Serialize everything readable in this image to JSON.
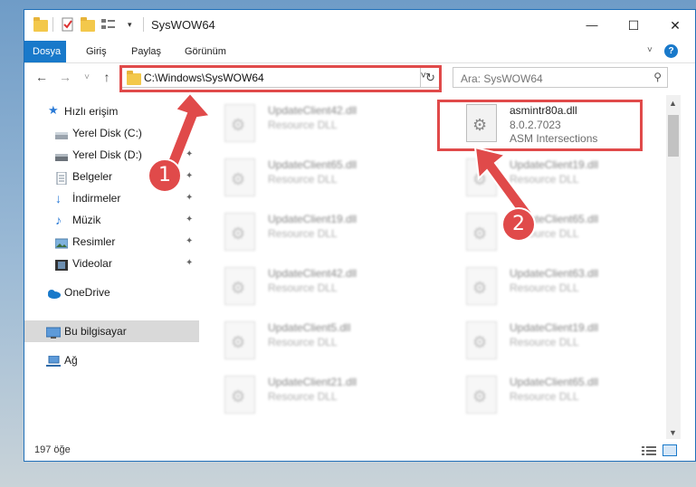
{
  "window": {
    "title": "SysWOW64",
    "minimize": "—",
    "maximize": "☐",
    "close": "✕"
  },
  "ribbon": {
    "tabs": [
      "Dosya",
      "Giriş",
      "Paylaş",
      "Görünüm"
    ],
    "help": "?"
  },
  "nav": {
    "back": "←",
    "forward": "→",
    "recent": "˅",
    "up": "↑"
  },
  "address": {
    "path": "C:\\Windows\\SysWOW64",
    "dropdown": "˅",
    "refresh": "↻"
  },
  "search": {
    "placeholder": "Ara: SysWOW64",
    "icon": "search-icon"
  },
  "sidebar": {
    "items": [
      {
        "label": "Hızlı erişim",
        "icon": "star-icon",
        "pinned": false
      },
      {
        "label": "Yerel Disk (C:)",
        "icon": "drive-icon",
        "pinned": true
      },
      {
        "label": "Yerel Disk (D:)",
        "icon": "drive-icon",
        "pinned": true
      },
      {
        "label": "Belgeler",
        "icon": "document-icon",
        "pinned": true
      },
      {
        "label": "İndirmeler",
        "icon": "download-icon",
        "pinned": true
      },
      {
        "label": "Müzik",
        "icon": "music-icon",
        "pinned": true
      },
      {
        "label": "Resimler",
        "icon": "pictures-icon",
        "pinned": true
      },
      {
        "label": "Videolar",
        "icon": "video-icon",
        "pinned": true
      },
      {
        "label": "OneDrive",
        "icon": "cloud-icon",
        "pinned": false
      },
      {
        "label": "Bu bilgisayar",
        "icon": "computer-icon",
        "pinned": false,
        "selected": true
      },
      {
        "label": "Ağ",
        "icon": "network-icon",
        "pinned": false
      }
    ],
    "pin_glyph": "📌"
  },
  "files": {
    "highlighted": {
      "name": "asmintr80a.dll",
      "version": "8.0.2.7023",
      "description": "ASM Intersections"
    },
    "left_column": [
      {
        "name": "UpdateClient42.dll",
        "type": "Resource DLL"
      },
      {
        "name": "UpdateClient65.dll",
        "type": "Resource DLL"
      },
      {
        "name": "UpdateClient19.dll",
        "type": "Resource DLL"
      },
      {
        "name": "UpdateClient42.dll",
        "type": "Resource DLL"
      },
      {
        "name": "UpdateClient5.dll",
        "type": "Resource DLL"
      },
      {
        "name": "UpdateClient21.dll",
        "type": "Resource DLL"
      }
    ],
    "right_column": [
      {
        "name": "UpdateClient19.dll",
        "type": "Resource DLL"
      },
      {
        "name": "UpdateClient65.dll",
        "type": "Resource DLL"
      },
      {
        "name": "UpdateClient63.dll",
        "type": "Resource DLL"
      },
      {
        "name": "UpdateClient19.dll",
        "type": "Resource DLL"
      },
      {
        "name": "UpdateClient65.dll",
        "type": "Resource DLL"
      }
    ]
  },
  "status": {
    "count": "197 öğe"
  },
  "callouts": [
    "1",
    "2"
  ],
  "colors": {
    "accent": "#1979ca",
    "highlight": "#e04a4a"
  }
}
